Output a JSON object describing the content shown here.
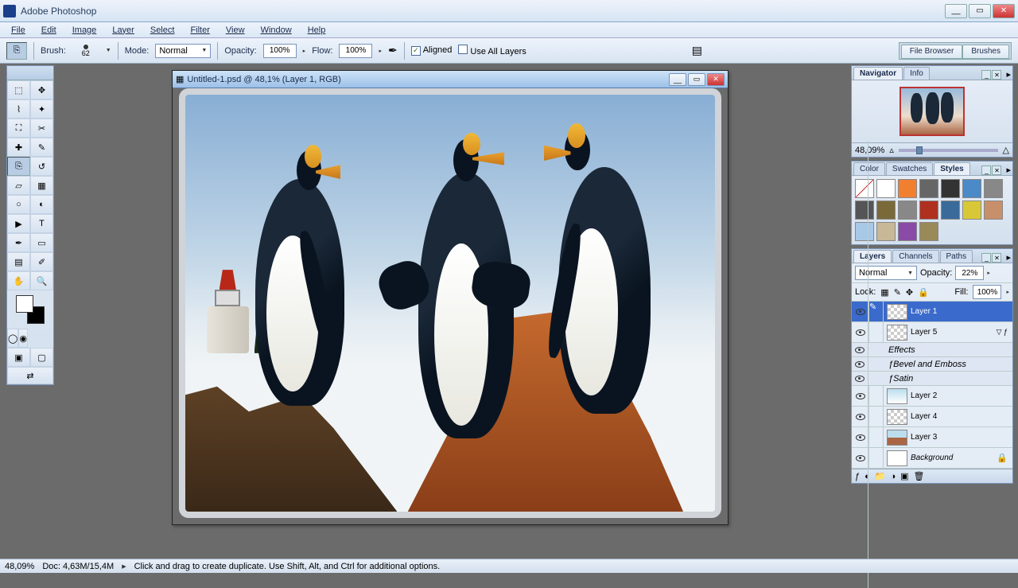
{
  "app": {
    "title": "Adobe Photoshop"
  },
  "menu": [
    "File",
    "Edit",
    "Image",
    "Layer",
    "Select",
    "Filter",
    "View",
    "Window",
    "Help"
  ],
  "optbar": {
    "brush_label": "Brush:",
    "brush_size": "62",
    "mode_label": "Mode:",
    "mode_value": "Normal",
    "opacity_label": "Opacity:",
    "opacity_value": "100%",
    "flow_label": "Flow:",
    "flow_value": "100%",
    "aligned": "Aligned",
    "use_all": "Use All Layers",
    "palette_tabs": [
      "File Browser",
      "Brushes"
    ]
  },
  "document": {
    "title": "Untitled-1.psd @ 48,1% (Layer 1, RGB)"
  },
  "navigator": {
    "tab1": "Navigator",
    "tab2": "Info",
    "zoom": "48,09%"
  },
  "color_panel": {
    "tab1": "Color",
    "tab2": "Swatches",
    "tab3": "Styles"
  },
  "layers_panel": {
    "tab1": "Layers",
    "tab2": "Channels",
    "tab3": "Paths",
    "blend": "Normal",
    "opacity_label": "Opacity:",
    "opacity": "22%",
    "lock_label": "Lock:",
    "fill_label": "Fill:",
    "fill": "100%",
    "effects_label": "Effects",
    "fx1": "Bevel and Emboss",
    "fx2": "Satin",
    "layers": [
      {
        "name": "Layer 1",
        "sel": true
      },
      {
        "name": "Layer 5",
        "fx": true
      },
      {
        "name": "Layer 2"
      },
      {
        "name": "Layer 4"
      },
      {
        "name": "Layer 3"
      },
      {
        "name": "Background",
        "locked": true
      }
    ]
  },
  "status": {
    "zoom": "48,09%",
    "doc": "Doc: 4,63M/15,4M",
    "hint": "Click and drag to create duplicate. Use Shift, Alt, and Ctrl for additional options."
  },
  "style_colors": [
    "#fff",
    "#f08030",
    "#666",
    "#333",
    "#4a8ac8",
    "#888",
    "#555",
    "#7a6a3a",
    "#888",
    "#b03020",
    "#3a6a9a",
    "#d8c838",
    "#c8906a",
    "#a8c8e8",
    "#c8b898",
    "#8a4aa8",
    "#9a8a5a"
  ]
}
